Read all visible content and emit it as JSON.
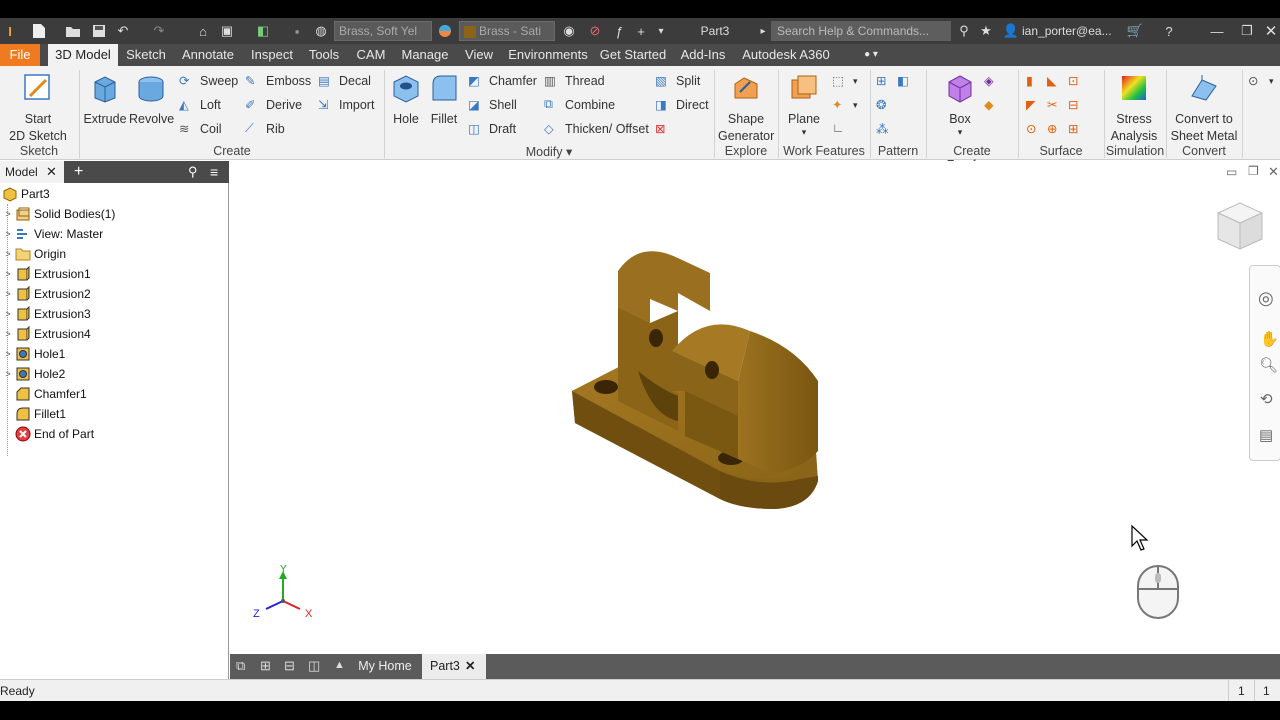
{
  "qat": {
    "material": "Brass, Soft Yel",
    "appearance": "Brass - Sati",
    "doc_title": "Part3",
    "search_placeholder": "Search Help & Commands...",
    "user": "ian_porter@ea..."
  },
  "tabs": [
    "File",
    "3D Model",
    "Sketch",
    "Annotate",
    "Inspect",
    "Tools",
    "CAM",
    "Manage",
    "View",
    "Environments",
    "Get Started",
    "Add-Ins",
    "Autodesk A360"
  ],
  "ribbon": {
    "start_sketch_1": "Start",
    "start_sketch_2": "2D Sketch",
    "extrude": "Extrude",
    "revolve": "Revolve",
    "sweep": "Sweep",
    "emboss": "Emboss",
    "decal": "Decal",
    "loft": "Loft",
    "derive": "Derive",
    "import": "Import",
    "coil": "Coil",
    "rib": "Rib",
    "hole": "Hole",
    "fillet": "Fillet",
    "chamfer": "Chamfer",
    "thread": "Thread",
    "split": "Split",
    "shell": "Shell",
    "combine": "Combine",
    "direct": "Direct",
    "draft": "Draft",
    "thicken": "Thicken/ Offset",
    "shape_gen_1": "Shape",
    "shape_gen_2": "Generator",
    "plane": "Plane",
    "box": "Box",
    "stress_1": "Stress",
    "stress_2": "Analysis",
    "sheet_1": "Convert to",
    "sheet_2": "Sheet Metal",
    "panels": {
      "sketch": "Sketch",
      "create": "Create",
      "modify": "Modify",
      "explore": "Explore",
      "work": "Work Features",
      "pattern": "Pattern",
      "freeform": "Create Freeform",
      "surface": "Surface",
      "simulation": "Simulation",
      "convert": "Convert"
    }
  },
  "browser": {
    "tab": "Model",
    "items": [
      {
        "label": "Part3",
        "icon": "part-icon",
        "expander": ""
      },
      {
        "label": "Solid Bodies(1)",
        "icon": "solid-bodies-icon",
        "expander": ">"
      },
      {
        "label": "View: Master",
        "icon": "view-icon",
        "expander": ">"
      },
      {
        "label": "Origin",
        "icon": "folder-icon",
        "expander": ">"
      },
      {
        "label": "Extrusion1",
        "icon": "extrusion-icon",
        "expander": ">"
      },
      {
        "label": "Extrusion2",
        "icon": "extrusion-icon",
        "expander": ">"
      },
      {
        "label": "Extrusion3",
        "icon": "extrusion-icon",
        "expander": ">"
      },
      {
        "label": "Extrusion4",
        "icon": "extrusion-icon",
        "expander": ">"
      },
      {
        "label": "Hole1",
        "icon": "hole-icon",
        "expander": ">"
      },
      {
        "label": "Hole2",
        "icon": "hole-icon",
        "expander": ">"
      },
      {
        "label": "Chamfer1",
        "icon": "chamfer-icon",
        "expander": ""
      },
      {
        "label": "Fillet1",
        "icon": "fillet-icon",
        "expander": ""
      },
      {
        "label": "End of Part",
        "icon": "end-of-part-icon",
        "expander": ""
      }
    ]
  },
  "triad": {
    "x": "X",
    "y": "Y",
    "z": "Z"
  },
  "doc_tabs": {
    "home": "My Home",
    "part": "Part3"
  },
  "status": {
    "text": "Ready",
    "n1": "1",
    "n2": "1"
  },
  "colors": {
    "accent": "#f07a20",
    "brass": "#8a6418"
  }
}
